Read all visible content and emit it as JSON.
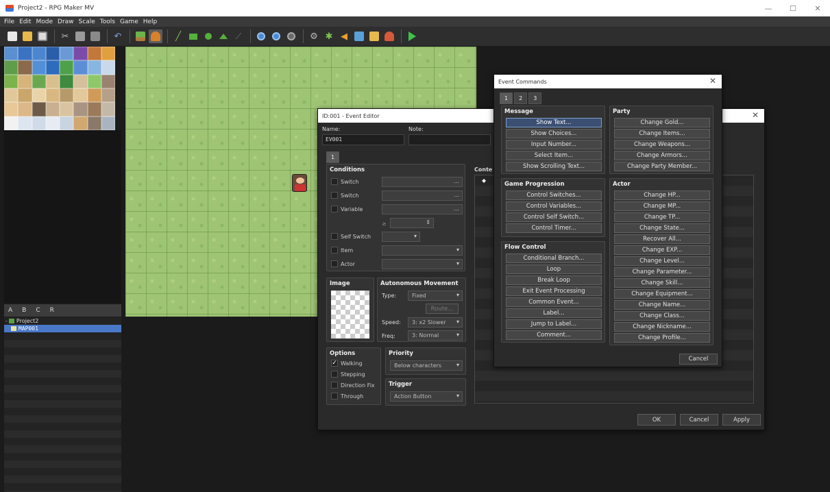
{
  "window": {
    "title": "Project2 - RPG Maker MV",
    "minimize": "—",
    "maximize": "☐",
    "close": "✕"
  },
  "menu": [
    "File",
    "Edit",
    "Mode",
    "Draw",
    "Scale",
    "Tools",
    "Game",
    "Help"
  ],
  "toolbar": {
    "icons": [
      "new-project-icon",
      "open-project-icon",
      "save-project-icon",
      "cut-icon",
      "copy-icon",
      "paste-icon",
      "undo-icon",
      "map-mode-icon",
      "event-mode-icon",
      "pencil-icon",
      "rectangle-icon",
      "ellipse-icon",
      "fill-icon",
      "shadow-pen-icon",
      "zoom-in-icon",
      "zoom-out-icon",
      "zoom-actual-icon",
      "database-icon",
      "plugin-manager-icon",
      "sound-test-icon",
      "event-searcher-icon",
      "resource-manager-icon",
      "character-generator-icon",
      "playtest-icon"
    ]
  },
  "palette": {
    "tabs": [
      "A",
      "B",
      "C",
      "R"
    ]
  },
  "map_tree": {
    "project": "Project2",
    "maps": [
      "MAP001"
    ]
  },
  "event_editor": {
    "title": "ID:001 - Event Editor",
    "name_label": "Name:",
    "name_value": "EV001",
    "note_label": "Note:",
    "note_value": "",
    "page_tab": "1",
    "conditions": {
      "title": "Conditions",
      "rows": [
        "Switch",
        "Switch",
        "Variable",
        "Self Switch",
        "Item",
        "Actor"
      ],
      "ellipsis": "...",
      "compare": "≥"
    },
    "image": {
      "title": "Image"
    },
    "autonomous": {
      "title": "Autonomous Movement",
      "type_label": "Type:",
      "type_value": "Fixed",
      "route_label": "Route...",
      "speed_label": "Speed:",
      "speed_value": "3: x2 Slower",
      "freq_label": "Freq:",
      "freq_value": "3: Normal"
    },
    "options": {
      "title": "Options",
      "items": [
        {
          "label": "Walking",
          "checked": true
        },
        {
          "label": "Stepping",
          "checked": false
        },
        {
          "label": "Direction Fix",
          "checked": false
        },
        {
          "label": "Through",
          "checked": false
        }
      ]
    },
    "priority": {
      "title": "Priority",
      "value": "Below characters"
    },
    "trigger": {
      "title": "Trigger",
      "value": "Action Button"
    },
    "contents": {
      "title": "Conte",
      "marker": "◆"
    },
    "buttons": {
      "ok": "OK",
      "cancel": "Cancel",
      "apply": "Apply"
    }
  },
  "event_commands": {
    "title": "Event Commands",
    "tabs": [
      "1",
      "2",
      "3"
    ],
    "groups": {
      "message": {
        "title": "Message",
        "items": [
          "Show Text...",
          "Show Choices...",
          "Input Number...",
          "Select Item...",
          "Show Scrolling Text..."
        ]
      },
      "game_progression": {
        "title": "Game Progression",
        "items": [
          "Control Switches...",
          "Control Variables...",
          "Control Self Switch...",
          "Control Timer..."
        ]
      },
      "flow_control": {
        "title": "Flow Control",
        "items": [
          "Conditional Branch...",
          "Loop",
          "Break Loop",
          "Exit Event Processing",
          "Common Event...",
          "Label...",
          "Jump to Label...",
          "Comment..."
        ]
      },
      "party": {
        "title": "Party",
        "items": [
          "Change Gold...",
          "Change Items...",
          "Change Weapons...",
          "Change Armors...",
          "Change Party Member..."
        ]
      },
      "actor": {
        "title": "Actor",
        "items": [
          "Change HP...",
          "Change MP...",
          "Change TP...",
          "Change State...",
          "Recover All...",
          "Change EXP...",
          "Change Level...",
          "Change Parameter...",
          "Change Skill...",
          "Change Equipment...",
          "Change Name...",
          "Change Class...",
          "Change Nickname...",
          "Change Profile..."
        ]
      }
    },
    "cancel": "Cancel"
  }
}
